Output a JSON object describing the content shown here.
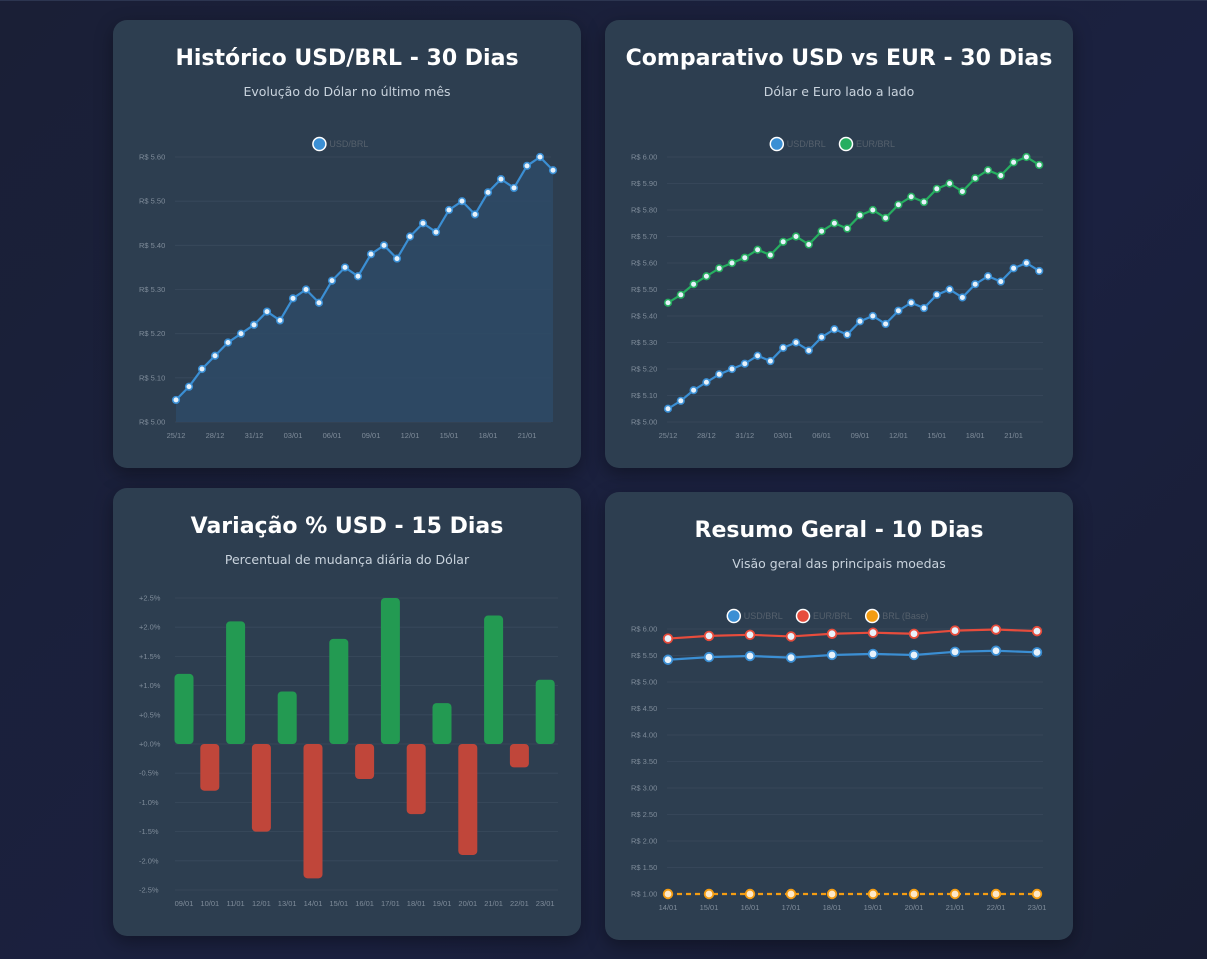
{
  "colors": {
    "usd": "#3b8fd4",
    "eur": "#27ae60",
    "brl": "#f39c12",
    "eur_summary": "#e74c3c",
    "positive": "#239a52",
    "negative": "#c0463a",
    "grid": "#3a4a5c",
    "tick": "#7f8c9a",
    "area": "#2e4a66"
  },
  "chart_data": [
    {
      "type": "area",
      "title": "Histórico USD/BRL - 30 Dias",
      "subtitle": "Evolução do Dólar no último mês",
      "legend": "top",
      "grid": true,
      "ylim": [
        5.0,
        5.6
      ],
      "yticks": [
        "R$ 5.00",
        "R$ 5.10",
        "R$ 5.20",
        "R$ 5.30",
        "R$ 5.40",
        "R$ 5.50",
        "R$ 5.60"
      ],
      "xtick_labels": [
        "25/12",
        "28/12",
        "31/12",
        "03/01",
        "06/01",
        "09/01",
        "12/01",
        "15/01",
        "18/01",
        "21/01"
      ],
      "series": [
        {
          "name": "USD/BRL",
          "values": [
            5.05,
            5.08,
            5.12,
            5.15,
            5.18,
            5.2,
            5.22,
            5.25,
            5.23,
            5.28,
            5.3,
            5.27,
            5.32,
            5.35,
            5.33,
            5.38,
            5.4,
            5.37,
            5.42,
            5.45,
            5.43,
            5.48,
            5.5,
            5.47,
            5.52,
            5.55,
            5.53,
            5.58,
            5.6,
            5.57
          ]
        }
      ]
    },
    {
      "type": "line",
      "title": "Comparativo USD vs EUR - 30 Dias",
      "subtitle": "Dólar e Euro lado a lado",
      "legend": "top",
      "grid": true,
      "ylim": [
        5.0,
        6.0
      ],
      "yticks": [
        "R$ 5.00",
        "R$ 5.10",
        "R$ 5.20",
        "R$ 5.30",
        "R$ 5.40",
        "R$ 5.50",
        "R$ 5.60",
        "R$ 5.70",
        "R$ 5.80",
        "R$ 5.90",
        "R$ 6.00"
      ],
      "xtick_labels": [
        "25/12",
        "28/12",
        "31/12",
        "03/01",
        "06/01",
        "09/01",
        "12/01",
        "15/01",
        "18/01",
        "21/01"
      ],
      "series": [
        {
          "name": "USD/BRL",
          "values": [
            5.05,
            5.08,
            5.12,
            5.15,
            5.18,
            5.2,
            5.22,
            5.25,
            5.23,
            5.28,
            5.3,
            5.27,
            5.32,
            5.35,
            5.33,
            5.38,
            5.4,
            5.37,
            5.42,
            5.45,
            5.43,
            5.48,
            5.5,
            5.47,
            5.52,
            5.55,
            5.53,
            5.58,
            5.6,
            5.57
          ]
        },
        {
          "name": "EUR/BRL",
          "values": [
            5.45,
            5.48,
            5.52,
            5.55,
            5.58,
            5.6,
            5.62,
            5.65,
            5.63,
            5.68,
            5.7,
            5.67,
            5.72,
            5.75,
            5.73,
            5.78,
            5.8,
            5.77,
            5.82,
            5.85,
            5.83,
            5.88,
            5.9,
            5.87,
            5.92,
            5.95,
            5.93,
            5.98,
            6.0,
            5.97
          ]
        }
      ]
    },
    {
      "type": "bar",
      "title": "Variação % USD - 15 Dias",
      "subtitle": "Percentual de mudança diária do Dólar",
      "grid": true,
      "ylim": [
        -2.5,
        2.5
      ],
      "yticks": [
        "-2.5%",
        "-2.0%",
        "-1.5%",
        "-1.0%",
        "-0.5%",
        "+0.0%",
        "+0.5%",
        "+1.0%",
        "+1.5%",
        "+2.0%",
        "+2.5%"
      ],
      "categories": [
        "09/01",
        "10/01",
        "11/01",
        "12/01",
        "13/01",
        "14/01",
        "15/01",
        "16/01",
        "17/01",
        "18/01",
        "19/01",
        "20/01",
        "21/01",
        "22/01",
        "23/01"
      ],
      "values": [
        1.2,
        -0.8,
        2.1,
        -1.5,
        0.9,
        -2.3,
        1.8,
        -0.6,
        2.5,
        -1.2,
        0.7,
        -1.9,
        2.2,
        -0.4,
        1.1
      ]
    },
    {
      "type": "line",
      "title": "Resumo Geral - 10 Dias",
      "subtitle": "Visão geral das principais moedas",
      "legend": "top",
      "grid": true,
      "ylim": [
        1.0,
        6.0
      ],
      "yticks": [
        "R$ 1.00",
        "R$ 1.50",
        "R$ 2.00",
        "R$ 2.50",
        "R$ 3.00",
        "R$ 3.50",
        "R$ 4.00",
        "R$ 4.50",
        "R$ 5.00",
        "R$ 5.50",
        "R$ 6.00"
      ],
      "categories": [
        "14/01",
        "15/01",
        "16/01",
        "17/01",
        "18/01",
        "19/01",
        "20/01",
        "21/01",
        "22/01",
        "23/01"
      ],
      "series": [
        {
          "name": "USD/BRL",
          "values": [
            5.42,
            5.47,
            5.49,
            5.46,
            5.51,
            5.53,
            5.51,
            5.57,
            5.59,
            5.56
          ]
        },
        {
          "name": "EUR/BRL",
          "values": [
            5.82,
            5.87,
            5.89,
            5.86,
            5.91,
            5.93,
            5.91,
            5.97,
            5.99,
            5.96
          ]
        },
        {
          "name": "BRL (Base)",
          "values": [
            1,
            1,
            1,
            1,
            1,
            1,
            1,
            1,
            1,
            1
          ]
        }
      ]
    }
  ]
}
